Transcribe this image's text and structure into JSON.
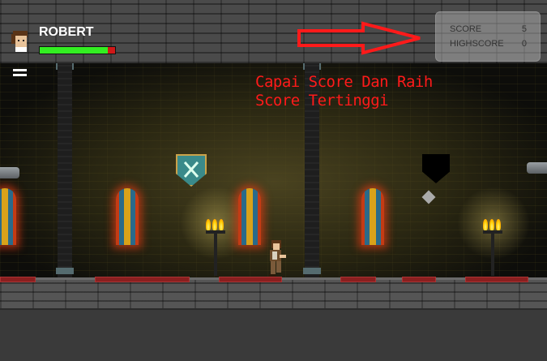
{
  "hud": {
    "player_name": "ROBERT",
    "health_fraction": 0.9,
    "menu_icon": "hamburger-menu-icon",
    "avatar_icon": "player-portrait-icon"
  },
  "score_panel": {
    "score_label": "SCORE",
    "score_value": "5",
    "highscore_label": "HIGHSCORE",
    "highscore_value": "0"
  },
  "hint": {
    "line1": "Capai Score Dan Raih",
    "line2": "Score Tertinggi",
    "arrow_icon": "right-arrow-icon"
  },
  "colors": {
    "hint": "#ff1a1a",
    "health": "#33ee22",
    "health_empty": "#d01818"
  }
}
